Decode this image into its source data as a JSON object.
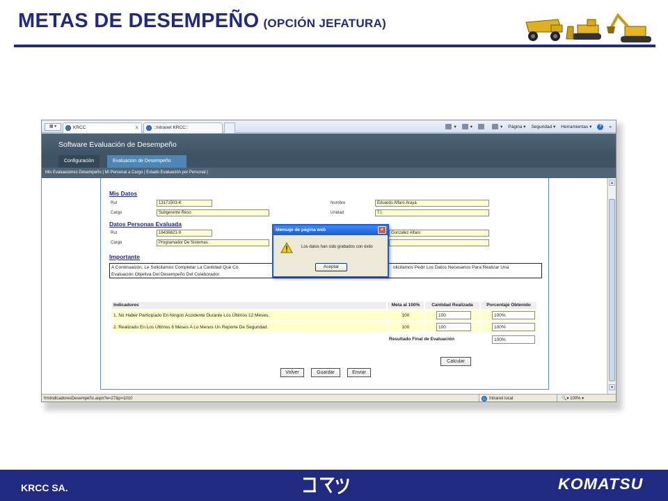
{
  "slide": {
    "title": "METAS DE DESEMPEÑO",
    "subtitle": "(OPCIÓN JEFATURA)",
    "footer_left": "KRCC SA.",
    "footer_kana": "コマツ",
    "footer_brand": "KOMATSU",
    "colors": {
      "title": "#1f2a80",
      "footer_band": "#1f2a80"
    }
  },
  "browser": {
    "tabs": [
      {
        "label": "KRCC",
        "active": true
      },
      {
        "label": "::Intranet KRCC::",
        "active": false
      }
    ],
    "command_bar": [
      "Página ▾",
      "Seguridad ▾",
      "Herramientas ▾"
    ],
    "status_url": "frmIndicadoresDesempeño.aspx?e=27&p=1010",
    "status_zone": "Intranet local",
    "zoom": "100%"
  },
  "app": {
    "title": "Software Evaluación de Desempeño",
    "tabs": [
      "Configuración",
      "Evaluacion de Desempeño"
    ],
    "subnav": "Mis Evaluaciones Desempeño | Mi Personal a Cargo | Estado Evaluación por Personal |"
  },
  "mis_datos": {
    "heading": "Mis Datos",
    "rut_label": "Rut",
    "rut": "13171503-K",
    "cargo_label": "Cargo",
    "cargo": "Subgerente Reso",
    "nombre_label": "Nombre",
    "nombre": "Eduardo Alfaro Araya",
    "unidad_label": "Unidad",
    "unidad": "T.I."
  },
  "evaluada": {
    "heading": "Datos Personas Evaluada",
    "rut_label": "Rut",
    "rut": "16436621-9",
    "cargo_label": "Cargo",
    "cargo": "Programador De Sistemas",
    "nombre": "Gonzalez Alfaro",
    "unidad": ""
  },
  "importante": {
    "heading": "Importante",
    "text_left_line1": "A Continuación, Le Solicitamos Completar La Cantidad Que Co",
    "text_right_line1": "olicitamos Pedir Los Datos Necesarios Para Realizar Una",
    "text_line2": "Evaluación Objetiva Del Desempeño Del Colaborador."
  },
  "indicadores": {
    "headers": [
      "Indicadores",
      "Meta al 100%",
      "Cantidad Realizada",
      "Porcentaje Obtenido"
    ],
    "rows": [
      {
        "label": "1. No Haber Participado En Ningún Accidente Durante Los Últimos 12 Meses.",
        "meta": "100",
        "cantidad": "100",
        "porcentaje": "100%"
      },
      {
        "label": "2. Realizado En Los Últimos 6 Meses A Lo Menos Un Reporte De Seguridad.",
        "meta": "100",
        "cantidad": "100",
        "porcentaje": "100%"
      }
    ],
    "final_label": "Resultado Final de Evaluación",
    "final_value": "100%"
  },
  "buttons": {
    "calcular": "Calcular",
    "volver": "Volver",
    "guardar": "Guardar",
    "enviar": "Enviar"
  },
  "dialog": {
    "title": "Mensaje de página web",
    "message": "Los datos han sido grabados con éxito",
    "button": "Aceptar"
  }
}
